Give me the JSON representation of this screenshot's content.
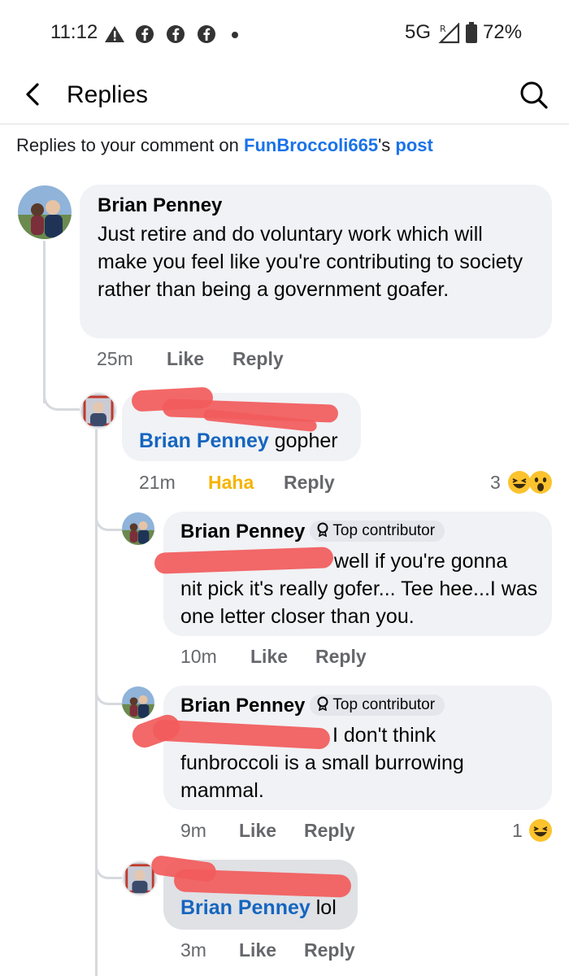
{
  "status_bar": {
    "time": "11:12",
    "network": "5G",
    "battery": "72%"
  },
  "header": {
    "title": "Replies"
  },
  "subheader": {
    "prefix": "Replies to your comment on ",
    "page_name": "FunBroccoli665",
    "possessive": "'s ",
    "post_link": "post"
  },
  "comments": [
    {
      "author": "Brian Penney",
      "text": "Just retire and do voluntary work which will make you feel like you're contributing to society rather than being a government goafer.",
      "time": "25m",
      "like": "Like",
      "reply": "Reply"
    },
    {
      "mention": "Brian Penney",
      "text": "gopher",
      "time": "21m",
      "like": "Haha",
      "reply": "Reply",
      "reaction_count": "3"
    },
    {
      "author": "Brian Penney",
      "badge": "Top contributor",
      "text_line1": "well if you're gonna",
      "text_rest": "nit pick it's really gofer... Tee hee...I was one letter closer than you.",
      "time": "10m",
      "like": "Like",
      "reply": "Reply"
    },
    {
      "author": "Brian Penney",
      "badge": "Top contributor",
      "text_line1": "I don't think",
      "text_rest": "funbroccoli is a small burrowing mammal.",
      "time": "9m",
      "like": "Like",
      "reply": "Reply",
      "reaction_count": "1"
    },
    {
      "mention": "Brian Penney",
      "text": "lol",
      "time": "3m",
      "like": "Like",
      "reply": "Reply"
    }
  ],
  "colors": {
    "link": "#1a73e8",
    "mention": "#1565c0",
    "haha": "#f5b400",
    "bubble": "#f0f2f5",
    "redaction": "#f25b5b"
  }
}
